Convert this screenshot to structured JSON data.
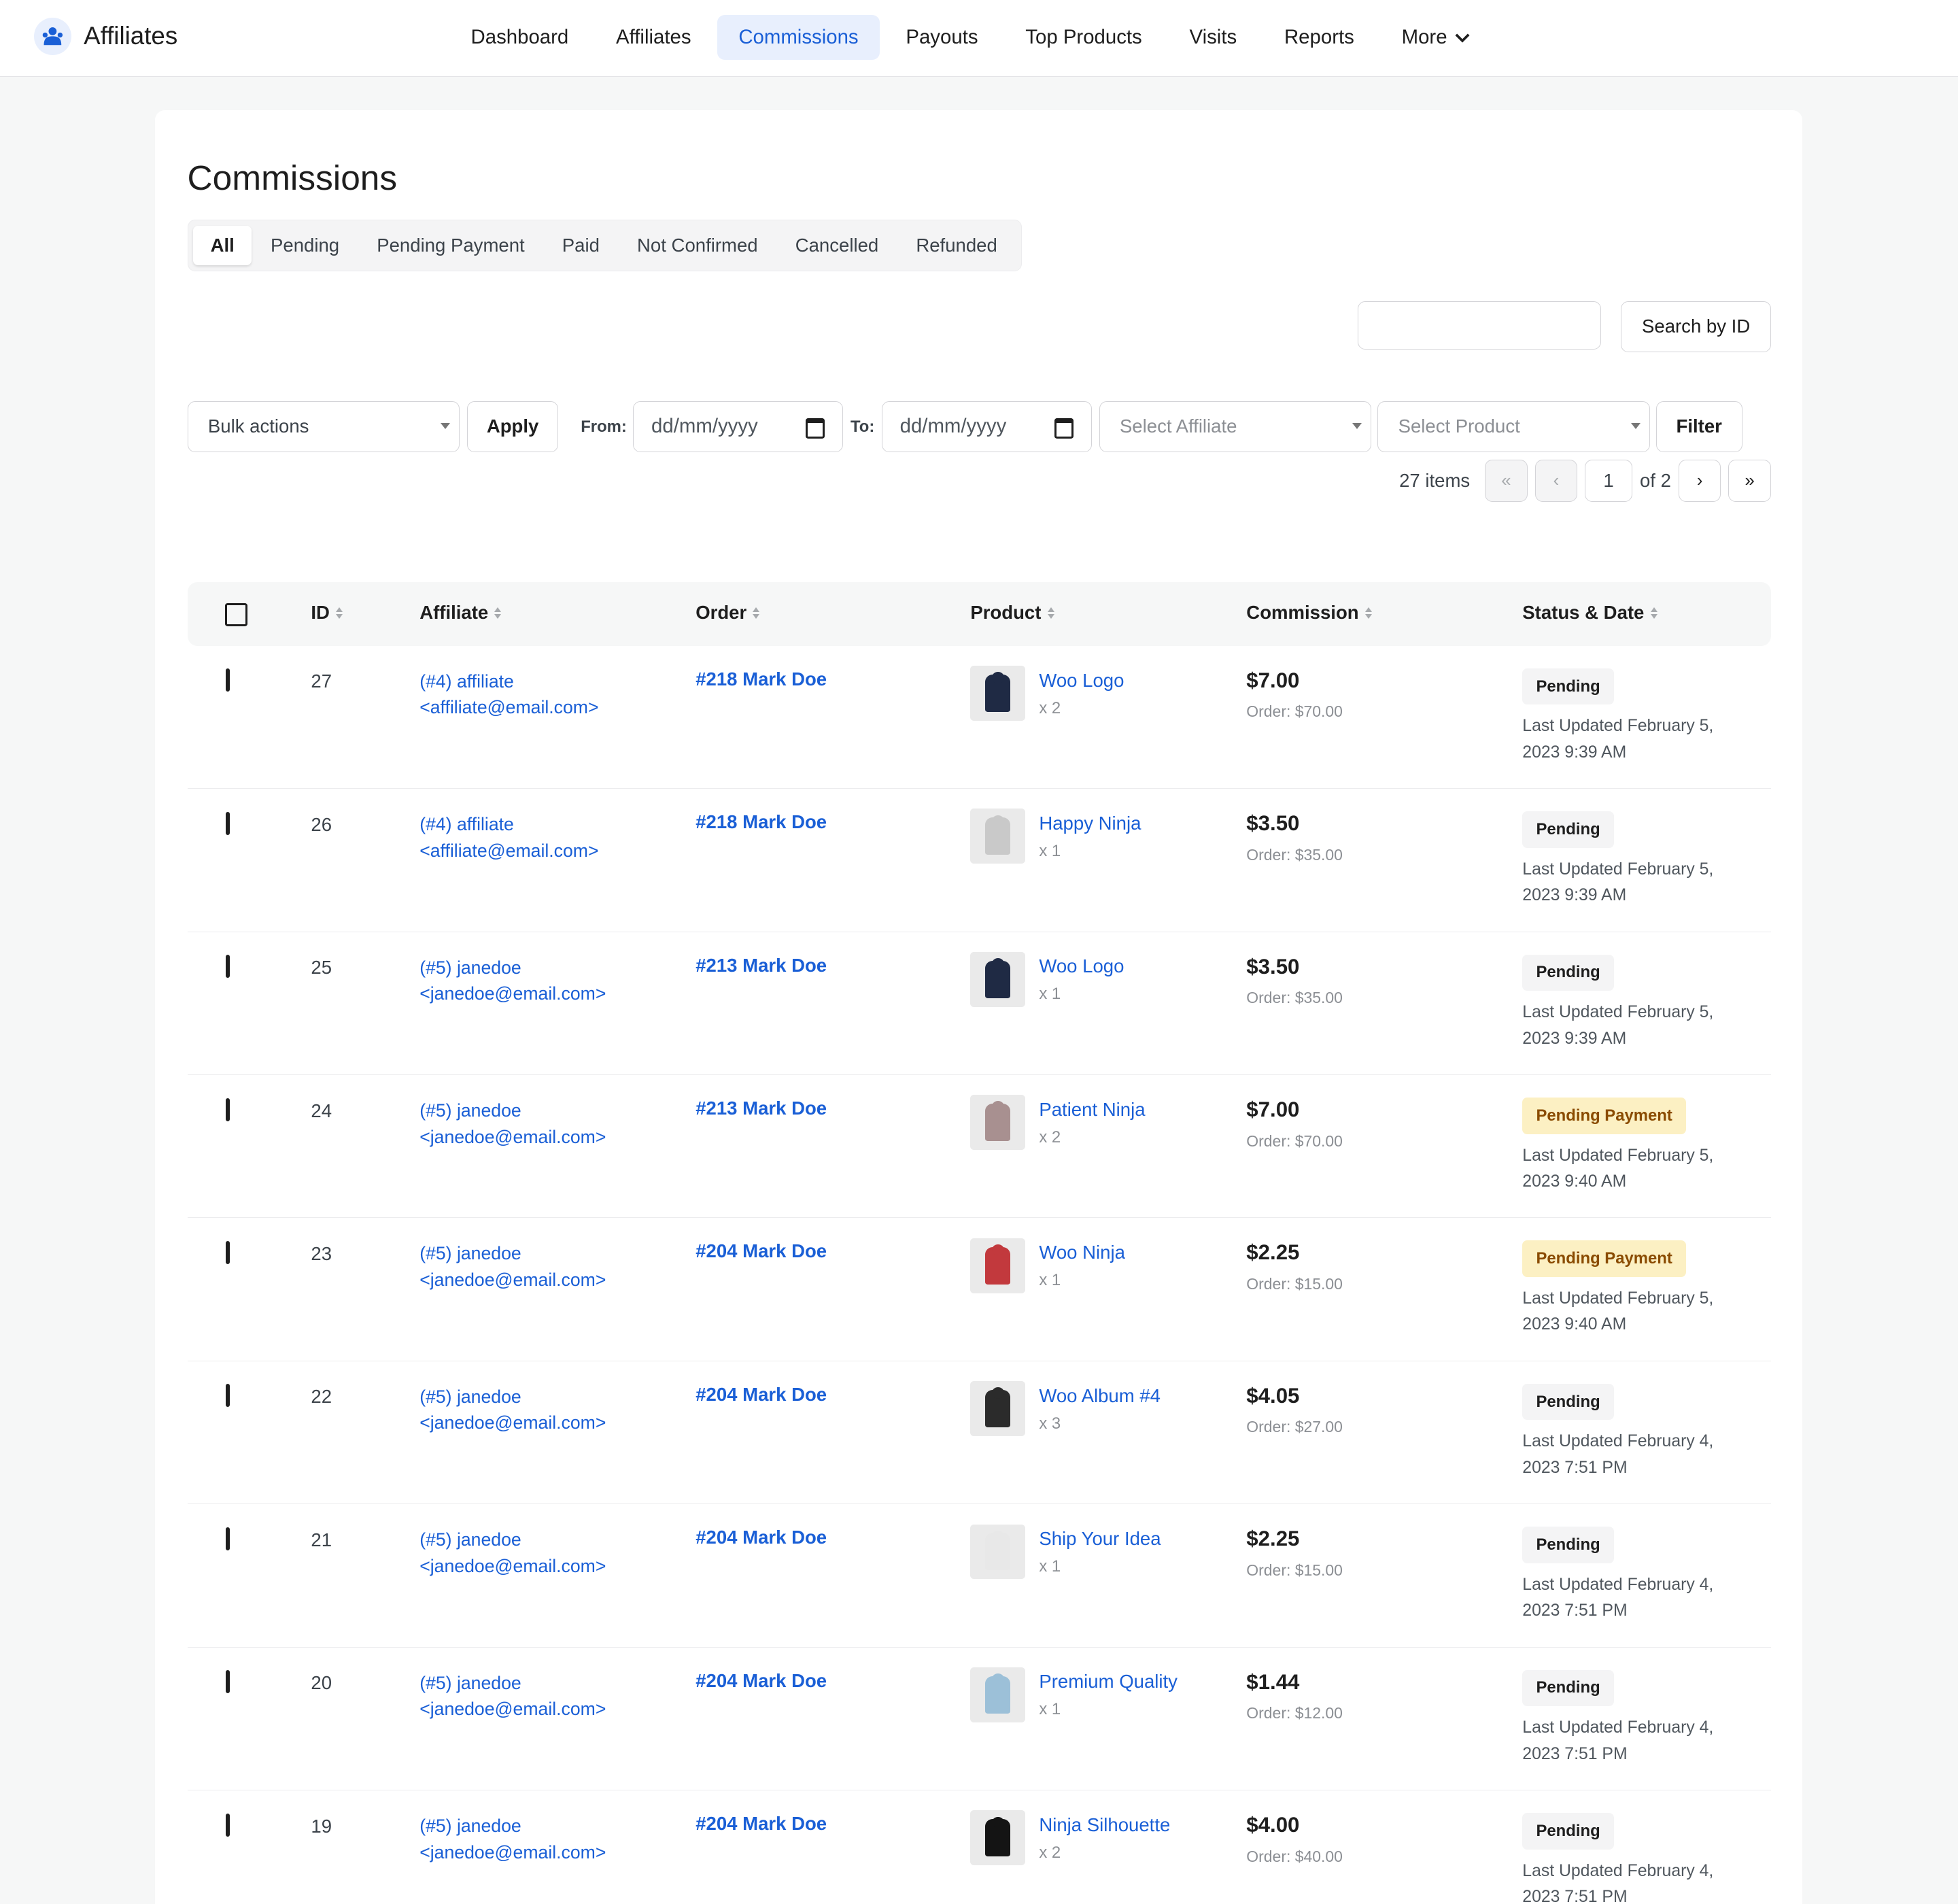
{
  "app": {
    "name": "Affiliates",
    "icon": "affiliates-logo-icon"
  },
  "nav": {
    "items": [
      {
        "label": "Dashboard",
        "active": false
      },
      {
        "label": "Affiliates",
        "active": false
      },
      {
        "label": "Commissions",
        "active": true
      },
      {
        "label": "Payouts",
        "active": false
      },
      {
        "label": "Top Products",
        "active": false
      },
      {
        "label": "Visits",
        "active": false
      },
      {
        "label": "Reports",
        "active": false
      },
      {
        "label": "More",
        "active": false,
        "icon": "chevron-down-icon"
      }
    ]
  },
  "page": {
    "title": "Commissions"
  },
  "status_tabs": [
    {
      "label": "All",
      "active": true
    },
    {
      "label": "Pending",
      "active": false
    },
    {
      "label": "Pending Payment",
      "active": false
    },
    {
      "label": "Paid",
      "active": false
    },
    {
      "label": "Not Confirmed",
      "active": false
    },
    {
      "label": "Cancelled",
      "active": false
    },
    {
      "label": "Refunded",
      "active": false
    }
  ],
  "search": {
    "value": "",
    "button_label": "Search by ID"
  },
  "filters": {
    "bulk_actions": "Bulk actions",
    "apply_label": "Apply",
    "from_label": "From:",
    "from_placeholder": "dd/mm/yyyy",
    "to_label": "To:",
    "to_placeholder": "dd/mm/yyyy",
    "affiliate_placeholder": "Select Affiliate",
    "product_placeholder": "Select Product",
    "filter_label": "Filter"
  },
  "pagination": {
    "items_count": "27 items",
    "first": "«",
    "prev": "‹",
    "current_page": "1",
    "of_label": "of 2",
    "next": "›",
    "last": "»"
  },
  "table": {
    "columns": [
      "ID",
      "Affiliate",
      "Order",
      "Product",
      "Commission",
      "Status & Date"
    ],
    "rows": [
      {
        "id": "27",
        "affiliate_line1": "(#4) affiliate",
        "affiliate_line2": "<affiliate@email.com>",
        "order": "#218 Mark Doe",
        "product": "Woo Logo",
        "qty": "x 2",
        "thumb_color": "#1f2a44",
        "commission": "$7.00",
        "order_total": "Order: $70.00",
        "status": "Pending",
        "updated_line1": "Last Updated February 5,",
        "updated_line2": "2023 9:39 AM"
      },
      {
        "id": "26",
        "affiliate_line1": "(#4) affiliate",
        "affiliate_line2": "<affiliate@email.com>",
        "order": "#218 Mark Doe",
        "product": "Happy Ninja",
        "qty": "x 1",
        "thumb_color": "#c9c9c9",
        "commission": "$3.50",
        "order_total": "Order: $35.00",
        "status": "Pending",
        "updated_line1": "Last Updated February 5,",
        "updated_line2": "2023 9:39 AM"
      },
      {
        "id": "25",
        "affiliate_line1": "(#5) janedoe",
        "affiliate_line2": "<janedoe@email.com>",
        "order": "#213 Mark Doe",
        "product": "Woo Logo",
        "qty": "x 1",
        "thumb_color": "#1f2a44",
        "commission": "$3.50",
        "order_total": "Order: $35.00",
        "status": "Pending",
        "updated_line1": "Last Updated February 5,",
        "updated_line2": "2023 9:39 AM"
      },
      {
        "id": "24",
        "affiliate_line1": "(#5) janedoe",
        "affiliate_line2": "<janedoe@email.com>",
        "order": "#213 Mark Doe",
        "product": "Patient Ninja",
        "qty": "x 2",
        "thumb_color": "#a89090",
        "commission": "$7.00",
        "order_total": "Order: $70.00",
        "status": "Pending Payment",
        "updated_line1": "Last Updated February 5,",
        "updated_line2": "2023 9:40 AM"
      },
      {
        "id": "23",
        "affiliate_line1": "(#5) janedoe",
        "affiliate_line2": "<janedoe@email.com>",
        "order": "#204 Mark Doe",
        "product": "Woo Ninja",
        "qty": "x 1",
        "thumb_color": "#c2393d",
        "commission": "$2.25",
        "order_total": "Order: $15.00",
        "status": "Pending Payment",
        "updated_line1": "Last Updated February 5,",
        "updated_line2": "2023 9:40 AM"
      },
      {
        "id": "22",
        "affiliate_line1": "(#5) janedoe",
        "affiliate_line2": "<janedoe@email.com>",
        "order": "#204 Mark Doe",
        "product": "Woo Album #4",
        "qty": "x 3",
        "thumb_color": "#2b2b2b",
        "commission": "$4.05",
        "order_total": "Order: $27.00",
        "status": "Pending",
        "updated_line1": "Last Updated February 4,",
        "updated_line2": "2023 7:51 PM"
      },
      {
        "id": "21",
        "affiliate_line1": "(#5) janedoe",
        "affiliate_line2": "<janedoe@email.com>",
        "order": "#204 Mark Doe",
        "product": "Ship Your Idea",
        "qty": "x 1",
        "thumb_color": "#e8e8e8",
        "commission": "$2.25",
        "order_total": "Order: $15.00",
        "status": "Pending",
        "updated_line1": "Last Updated February 4,",
        "updated_line2": "2023 7:51 PM"
      },
      {
        "id": "20",
        "affiliate_line1": "(#5) janedoe",
        "affiliate_line2": "<janedoe@email.com>",
        "order": "#204 Mark Doe",
        "product": "Premium Quality",
        "qty": "x 1",
        "thumb_color": "#9cc0d8",
        "commission": "$1.44",
        "order_total": "Order: $12.00",
        "status": "Pending",
        "updated_line1": "Last Updated February 4,",
        "updated_line2": "2023 7:51 PM"
      },
      {
        "id": "19",
        "affiliate_line1": "(#5) janedoe",
        "affiliate_line2": "<janedoe@email.com>",
        "order": "#204 Mark Doe",
        "product": "Ninja Silhouette",
        "qty": "x 2",
        "thumb_color": "#141414",
        "commission": "$4.00",
        "order_total": "Order: $40.00",
        "status": "Pending",
        "updated_line1": "Last Updated February 4,",
        "updated_line2": "2023 7:51 PM"
      }
    ]
  },
  "colors": {
    "accent": "#1a5fd6",
    "active_nav_bg": "#e8effd",
    "pending_badge_bg": "#f4f4f5",
    "pending_payment_badge_bg": "#fcf0c3",
    "pending_payment_badge_text": "#8a4b00"
  }
}
